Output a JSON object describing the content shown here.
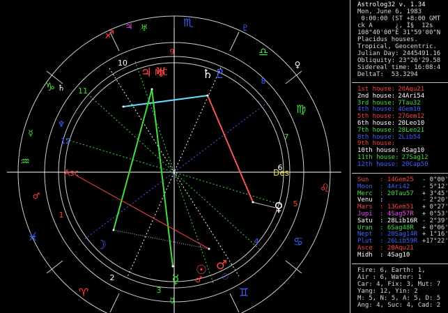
{
  "app": {
    "title": "Astrolog32 v. 1.34"
  },
  "header": [
    "Mon, June 6, 1983",
    " 0:00:00 (ST +8:00 GMT",
    "ck A      ¿, Ì§  12s",
    "108°40'00\"E 31°59'00\"N",
    "Placidus houses.",
    "Tropical, Geocentric.",
    "Julian Day: 2445491.16",
    "Obliquity: 23°26'29.58",
    "Sidereal time: 16:08:4",
    "DeltaT:  53.3294"
  ],
  "houses": [
    {
      "label": "1st house:",
      "value": "20Aqu21",
      "color": "#ff4040"
    },
    {
      "label": "2nd house:",
      "value": "24Ari54",
      "color": "#ffffff"
    },
    {
      "label": "3rd house:",
      "value": "7Tau32",
      "color": "#40e040"
    },
    {
      "label": "4th house:",
      "value": "4Gem10",
      "color": "#4060ff"
    },
    {
      "label": "5th house:",
      "value": "27Gem12",
      "color": "#ff4040"
    },
    {
      "label": "6th house:",
      "value": "20Leo10",
      "color": "#ffffff"
    },
    {
      "label": "7th house:",
      "value": "28Leo21",
      "color": "#40e040"
    },
    {
      "label": "8th house:",
      "value": "2Lib54",
      "color": "#4060ff"
    },
    {
      "label": "9th house:",
      "value": "",
      "color": "#ff4040"
    },
    {
      "label": "10th house:",
      "value": "4Sag10",
      "color": "#ffffff"
    },
    {
      "label": "11th house:",
      "value": "27Sag12",
      "color": "#40e040"
    },
    {
      "label": "12th house:",
      "value": "20Cap50",
      "color": "#4060ff"
    }
  ],
  "planets": [
    {
      "name": "Sun",
      "pos": "14Gem25",
      "aspect": "- 0°00'",
      "color": "#ff4040"
    },
    {
      "name": "Moon",
      "pos": "4Ari42",
      "aspect": "- 5°12'",
      "color": "#4060ff"
    },
    {
      "name": "Merc",
      "pos": "20Tau57",
      "aspect": "+ 3°45'",
      "color": "#40e040"
    },
    {
      "name": "Venu",
      "pos": "",
      "aspect": "- 2°20'",
      "color": "#ffffff"
    },
    {
      "name": "Mars",
      "pos": "13Gem51",
      "aspect": "+ 0°27'",
      "color": "#ff4040"
    },
    {
      "name": "Jupi",
      "pos": "4Sag57R",
      "aspect": "+ 0°53'",
      "color": "#ff40ff"
    },
    {
      "name": "Satu",
      "pos": "28Lib16R",
      "aspect": "- 2°39'",
      "color": "#ffffff"
    },
    {
      "name": "Uran",
      "pos": "6Sag48R",
      "aspect": "+ 0°06'",
      "color": "#40e040"
    },
    {
      "name": "Nept",
      "pos": "28Sag14R",
      "aspect": "+ 1°16'",
      "color": "#4060ff"
    },
    {
      "name": "Plut",
      "pos": "26Lib59R",
      "aspect": "+17°22'",
      "color": "#4060ff"
    },
    {
      "name": "Asce",
      "pos": "20Aqu21",
      "aspect": "",
      "color": "#ff4040"
    },
    {
      "name": "Midh",
      "pos": "4Sag10",
      "aspect": "",
      "color": "#ffffff"
    }
  ],
  "summary": [
    "Fire: 6, Earth: 1,",
    "Air : 6, Water: 1",
    "Car: 4, Fix: 3, Mut: 7",
    "Yang: 12, Yin: 2",
    "M: 5, N: 5, A: 5, D: 5",
    "Ang: 4, Suc: 4, Cad: 2"
  ],
  "wheel": {
    "axis_labels": {
      "asc": "Asc",
      "des": "Des",
      "mc": "MC"
    },
    "house_numbers": [
      "1",
      "2",
      "3",
      "4",
      "5",
      "6",
      "7",
      "8",
      "9",
      "10",
      "11",
      "12"
    ],
    "signs": [
      {
        "name": "aries",
        "glyph": "♈",
        "color": "#ff4040"
      },
      {
        "name": "taurus",
        "glyph": "♉",
        "color": "#40e040"
      },
      {
        "name": "gemini",
        "glyph": "♊",
        "color": "#4060ff"
      },
      {
        "name": "cancer",
        "glyph": "♋",
        "color": "#4060ff"
      },
      {
        "name": "leo",
        "glyph": "♌",
        "color": "#ff4040"
      },
      {
        "name": "virgo",
        "glyph": "♍",
        "color": "#40e040"
      },
      {
        "name": "libra",
        "glyph": "♎",
        "color": "#40e040"
      },
      {
        "name": "scorpio",
        "glyph": "♏",
        "color": "#4060ff"
      },
      {
        "name": "sagittarius",
        "glyph": "♐",
        "color": "#ff4040"
      },
      {
        "name": "capricorn",
        "glyph": "♑",
        "color": "#40e040"
      },
      {
        "name": "aquarius",
        "glyph": "♒",
        "color": "#40e040"
      },
      {
        "name": "pisces",
        "glyph": "♓",
        "color": "#4060ff"
      }
    ],
    "colors": {
      "red": "#ff4040",
      "green": "#40e040",
      "blue": "#4060ff",
      "white": "#ffffff",
      "cyan": "#60e0ff",
      "magenta": "#ff40ff",
      "yellow": "#e0e040"
    }
  }
}
